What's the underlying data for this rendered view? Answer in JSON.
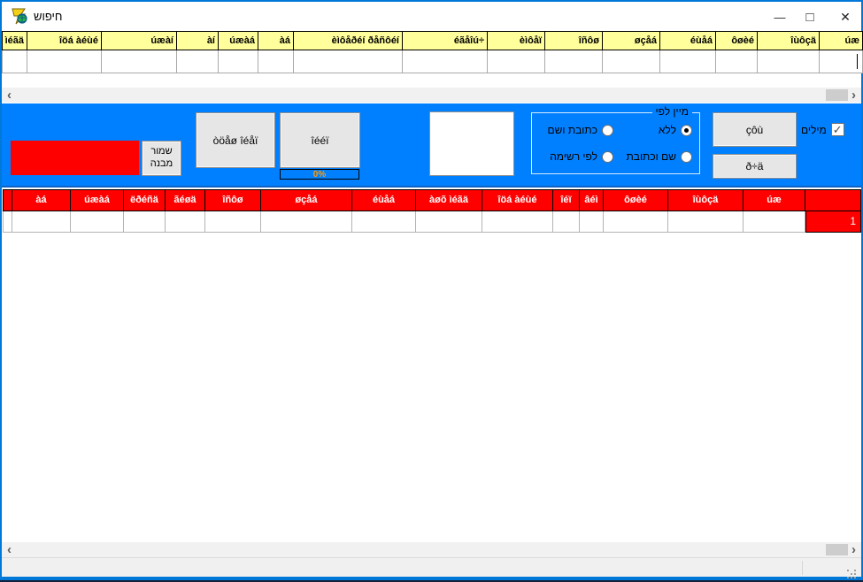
{
  "window": {
    "title": "חיפוש",
    "icons": {
      "minimize": "—",
      "maximize": "□",
      "close": "✕"
    }
  },
  "icons": {
    "check": "✓",
    "scroll_left": "‹",
    "scroll_right": "›"
  },
  "colors": {
    "frame_blue": "#0078d7",
    "band_blue": "#0080ff",
    "header_yellow": "#ffff9c",
    "grid_red": "#ff0000",
    "progress_text_orange": "#ff9a00"
  },
  "top_table": {
    "columns": [
      "ìéãä",
      "îöá àéùé",
      "úæàí",
      "àí",
      "úæàá",
      "àá",
      "èìôåðéí ðåñôéí",
      "éãåîú÷",
      "èìôåï",
      "îñôø",
      "øçåá",
      "éùåá",
      "ôøèé",
      "îùôçä",
      "úæ"
    ]
  },
  "toolbar": {
    "save_structure_label": "שמור מבנה",
    "stop_sort_label": "òöåø îéåï",
    "sort_label": "îééï",
    "progress_value": "0%",
    "search_label": "çôù",
    "clear_label": "ð÷ä",
    "words_label": "מילים",
    "words_checked": true,
    "sort_group": {
      "title": "מיין לפי",
      "options": [
        {
          "label": "ללא",
          "selected": true
        },
        {
          "label": "כתובת ושם",
          "selected": false
        },
        {
          "label": "שם וכתובת",
          "selected": false
        },
        {
          "label": "לפי רשימה",
          "selected": false
        }
      ]
    }
  },
  "results_table": {
    "columns": [
      "",
      "àá",
      "úæàá",
      "ëðéñä",
      "ãéøä",
      "îñôø",
      "øçåá",
      "éùåá",
      "àøõ ìéãä",
      "îöá àéùé",
      "îéï",
      "âéì",
      "ôøèé",
      "îùôçä",
      "úæ",
      ""
    ],
    "count": "1"
  }
}
